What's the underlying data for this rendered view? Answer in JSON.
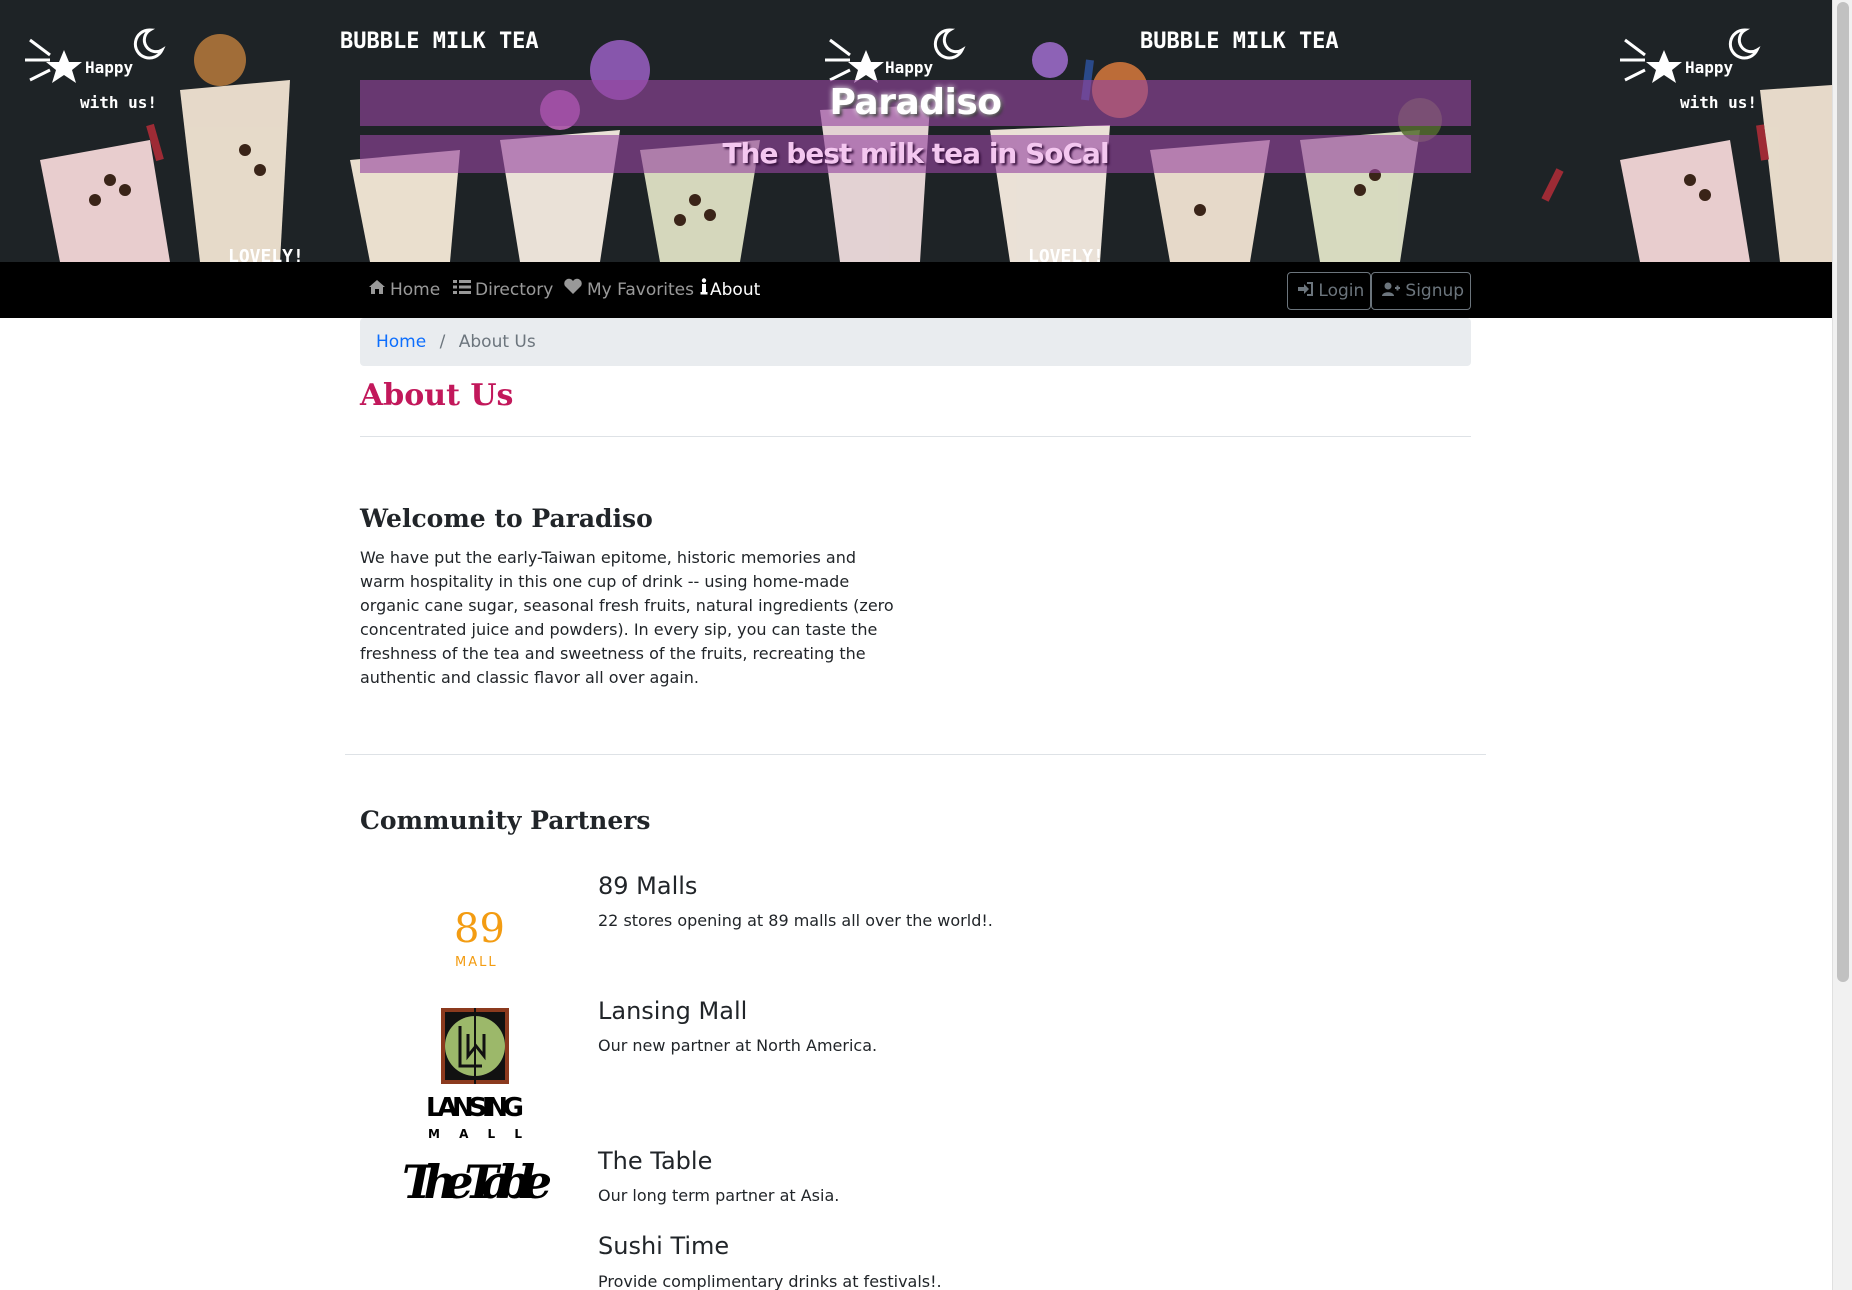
{
  "banner": {
    "title": "Paradiso",
    "tagline": "The best milk tea in SoCal",
    "decor_left_text": "Happy with us!",
    "decor_mid_text": "BUBBLE MILK TEA",
    "decor_bottom_text": "LOVELY!"
  },
  "navbar": {
    "items": [
      {
        "label": "Home",
        "icon": "home-icon",
        "active": false
      },
      {
        "label": "Directory",
        "icon": "list-icon",
        "active": false
      },
      {
        "label": "My Favorites",
        "icon": "heart-icon",
        "active": false
      },
      {
        "label": "About",
        "icon": "info-icon",
        "active": true
      }
    ],
    "login_label": "Login",
    "signup_label": "Signup"
  },
  "breadcrumb": {
    "home_label": "Home",
    "separator": "/",
    "current_label": "About Us"
  },
  "page": {
    "heading": "About Us",
    "welcome_heading": "Welcome to Paradiso",
    "welcome_text": "We have put the early-Taiwan epitome, historic memories and warm hospitality in this one cup of drink -- using home-made organic cane sugar, seasonal fresh fruits, natural ingredients (zero concentrated juice and powders). In every sip, you can taste the freshness of the tea and sweetness of the fruits, recreating the authentic and classic flavor all over again.",
    "partners_heading": "Community Partners"
  },
  "partners": [
    {
      "name": "89 Malls",
      "desc": "22 stores opening at 89 malls all over the world!.",
      "logo_text": "89",
      "logo_sub": "MALL"
    },
    {
      "name": "Lansing Mall",
      "desc": "Our new partner at North America.",
      "logo_text": "LANSING",
      "logo_sub": "M A L L"
    },
    {
      "name": "The Table",
      "desc": "Our long term partner at Asia.",
      "logo_text": "The Table"
    },
    {
      "name": "Sushi Time",
      "desc": "Provide complimentary drinks at festivals!."
    }
  ],
  "colors": {
    "heading_accent": "#c2185b",
    "link": "#0d6efd",
    "banner_bg": "#1e2326",
    "title_band": "#9646a0"
  }
}
